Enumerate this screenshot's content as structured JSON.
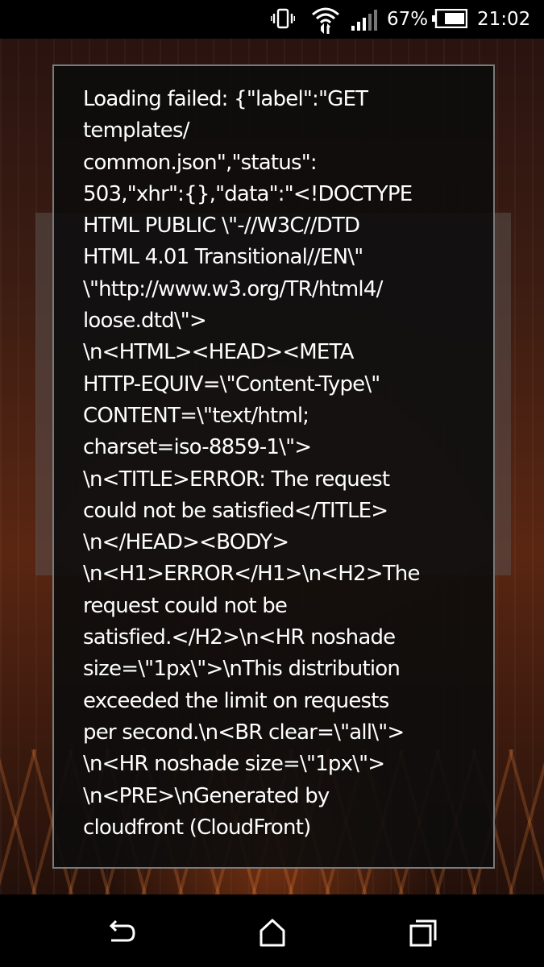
{
  "status_bar": {
    "battery_percent": "67%",
    "time": "21:02",
    "icons": [
      "vibrate-icon",
      "wifi-icon",
      "signal-icon",
      "battery-icon"
    ]
  },
  "dialog": {
    "lines": [
      "Loading failed: {\"label\":\"GET",
      "templates/",
      "common.json\",\"status\":",
      "503,\"xhr\":{},\"data\":\"<!DOCTYPE",
      "HTML PUBLIC \\\"-//W3C//DTD",
      "HTML 4.01 Transitional//EN\\\"",
      "\\\"http://www.w3.org/TR/html4/",
      "loose.dtd\\\">",
      "\\n<HTML><HEAD><META",
      "HTTP-EQUIV=\\\"Content-Type\\\"",
      "CONTENT=\\\"text/html;",
      "charset=iso-8859-1\\\">",
      "\\n<TITLE>ERROR: The request",
      "could not be satisfied</TITLE>",
      "\\n</HEAD><BODY>",
      "\\n<H1>ERROR</H1>\\n<H2>The",
      "request could not be",
      "satisfied.</H2>\\n<HR noshade",
      "size=\\\"1px\\\">\\nThis distribution",
      "exceeded the limit on requests",
      "per second.\\n<BR clear=\\\"all\\\">",
      "\\n<HR noshade size=\\\"1px\\\">",
      "\\n<PRE>\\nGenerated by",
      "cloudfront (CloudFront)"
    ]
  },
  "background": {
    "ghost_text": "",
    "accent_color": "#5a2612"
  },
  "nav_bar": {
    "buttons": [
      "back-icon",
      "home-icon",
      "recents-icon"
    ]
  }
}
